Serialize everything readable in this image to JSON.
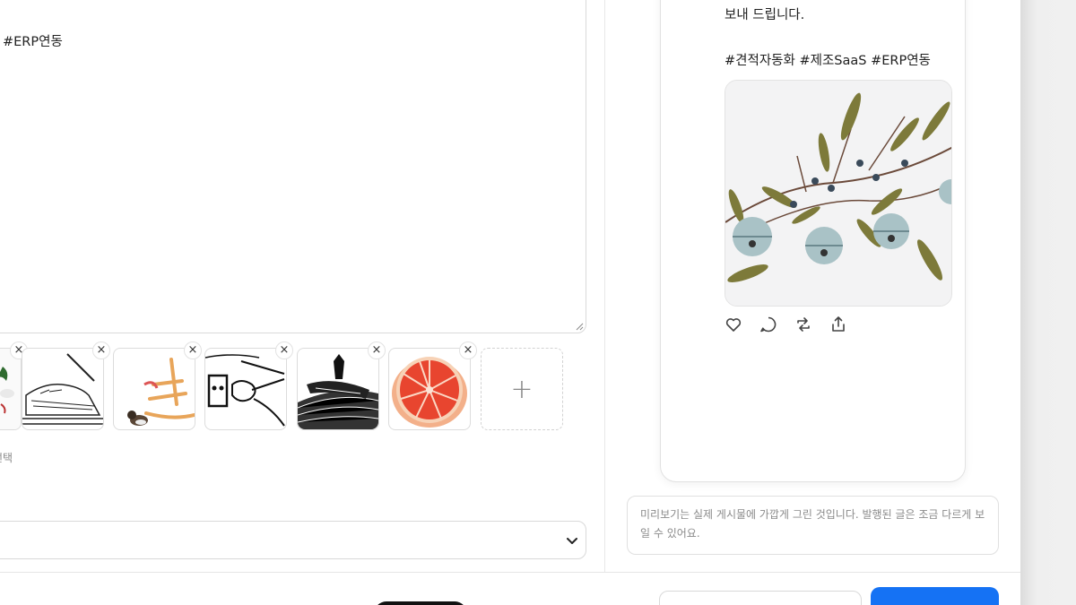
{
  "composer": {
    "text_visible": "#ERP연동",
    "image_select_hint": "선택",
    "add_image_label": "+",
    "remove_label": "×"
  },
  "preview": {
    "body_line": "보내 드립니다.",
    "hashtags": "#견적자동화 #제조SaaS #ERP연동",
    "actions": [
      "heart-icon",
      "comment-icon",
      "repost-icon",
      "share-icon"
    ],
    "note": "미리보기는 실제 게시물에 가깝게 그린 것입니다. 발행된 글은 조금 다르게 보일 수 있어요."
  },
  "footer": {
    "secondary_label": "",
    "primary_label": ""
  },
  "colors": {
    "accent": "#1572f4",
    "border": "#d9d9d9",
    "muted_text": "#8a8a8a"
  }
}
